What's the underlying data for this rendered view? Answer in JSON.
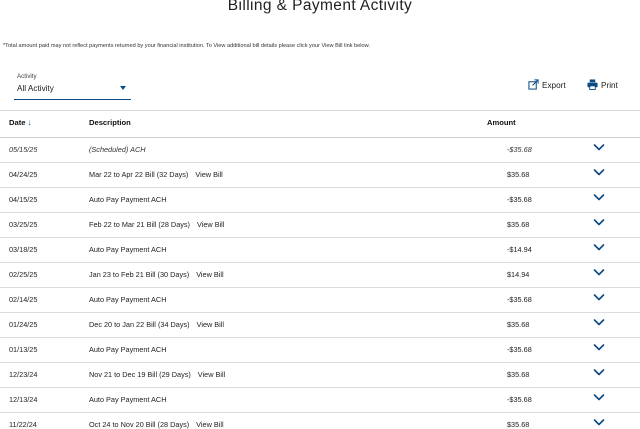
{
  "page": {
    "title": "Billing & Payment Activity",
    "note": "*Total amount paid may not reflect payments returned by your financial institution. To View additional bill details please click your View Bill link below."
  },
  "filter": {
    "label": "Activity",
    "value": "All Activity"
  },
  "actions": {
    "export_label": "Export",
    "print_label": "Print"
  },
  "table": {
    "headers": {
      "date": "Date",
      "description": "Description",
      "amount": "Amount"
    },
    "rows": [
      {
        "date": "05/15/25",
        "description": "(Scheduled) ACH",
        "view_bill": "",
        "amount": "-$35.68",
        "scheduled": true
      },
      {
        "date": "04/24/25",
        "description": "Mar 22 to Apr 22 Bill (32 Days)",
        "view_bill": "View Bill",
        "amount": "$35.68"
      },
      {
        "date": "04/15/25",
        "description": "Auto Pay Payment ACH",
        "view_bill": "",
        "amount": "-$35.68"
      },
      {
        "date": "03/25/25",
        "description": "Feb 22 to Mar 21 Bill (28 Days)",
        "view_bill": "View Bill",
        "amount": "$35.68"
      },
      {
        "date": "03/18/25",
        "description": "Auto Pay Payment ACH",
        "view_bill": "",
        "amount": "-$14.94"
      },
      {
        "date": "02/25/25",
        "description": "Jan 23 to Feb 21 Bill (30 Days)",
        "view_bill": "View Bill",
        "amount": "$14.94"
      },
      {
        "date": "02/14/25",
        "description": "Auto Pay Payment ACH",
        "view_bill": "",
        "amount": "-$35.68"
      },
      {
        "date": "01/24/25",
        "description": "Dec 20 to Jan 22 Bill (34 Days)",
        "view_bill": "View Bill",
        "amount": "$35.68"
      },
      {
        "date": "01/13/25",
        "description": "Auto Pay Payment ACH",
        "view_bill": "",
        "amount": "-$35.68"
      },
      {
        "date": "12/23/24",
        "description": "Nov 21 to Dec 19 Bill (29 Days)",
        "view_bill": "View Bill",
        "amount": "$35.68"
      },
      {
        "date": "12/13/24",
        "description": "Auto Pay Payment ACH",
        "view_bill": "",
        "amount": "-$35.68"
      },
      {
        "date": "11/22/24",
        "description": "Oct 24 to Nov 20 Bill (28 Days)",
        "view_bill": "View Bill",
        "amount": "$35.68"
      }
    ]
  },
  "icons": {
    "export": "export-icon",
    "print": "printer-icon",
    "sort": "arrow-down-icon",
    "expand": "chevron-down-icon"
  },
  "colors": {
    "accent": "#0b4a82",
    "divider": "#dcdcdc"
  }
}
